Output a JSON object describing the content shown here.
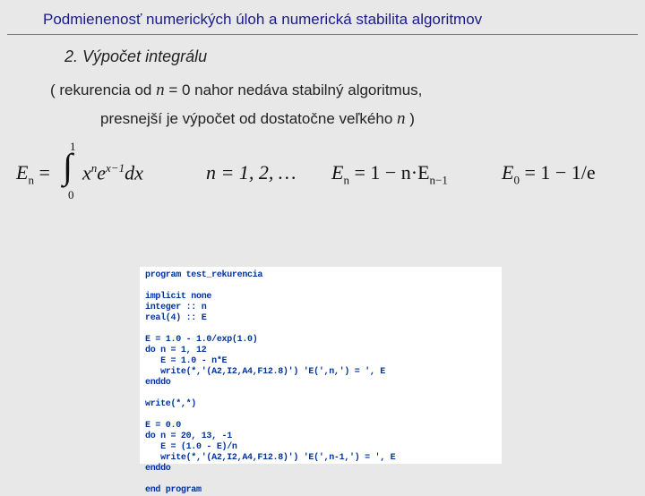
{
  "header": {
    "title": "Podmienenosť numerických úloh a numerická stabilita algoritmov"
  },
  "section": {
    "num": "2.",
    "title": "Výpočet integrálu"
  },
  "line1": {
    "open": "( rekurencia od ",
    "nvar": "n",
    "eqzero": " = 0 nahor nedáva stabilný algoritmus,"
  },
  "line2": {
    "a": "presnejší je výpočet od dostatočne veľkého ",
    "nvar": "n",
    "close": " )"
  },
  "math": {
    "En": "E",
    "n": "n",
    "eq1": "=",
    "int_lo": "0",
    "int_hi": "1",
    "integrand_x": "x",
    "integrand_exp_n": "n",
    "integrand_e": "e",
    "integrand_exp_x1": "x−1",
    "dx": "dx",
    "nrange": "n = 1, 2, …",
    "rec": "= 1 − n·E",
    "rec_sub": "n−1",
    "e0": "= 1 − 1/e",
    "e0sub": "0"
  },
  "code": {
    "l1": "program test_rekurencia",
    "l2": "",
    "l3": "implicit none",
    "l4": "integer :: n",
    "l5": "real(4) :: E",
    "l6": "",
    "l7": "E = 1.0 - 1.0/exp(1.0)",
    "l8": "do n = 1, 12",
    "l9": "   E = 1.0 - n*E",
    "l10": "   write(*,'(A2,I2,A4,F12.8)') 'E(',n,') = ', E",
    "l11": "enddo",
    "l12": "",
    "l13": "write(*,*)",
    "l14": "",
    "l15": "E = 0.0",
    "l16": "do n = 20, 13, -1",
    "l17": "   E = (1.0 - E)/n",
    "l18": "   write(*,'(A2,I2,A4,F12.8)') 'E(',n-1,') = ', E",
    "l19": "enddo",
    "l20": "",
    "l21": "end program"
  }
}
